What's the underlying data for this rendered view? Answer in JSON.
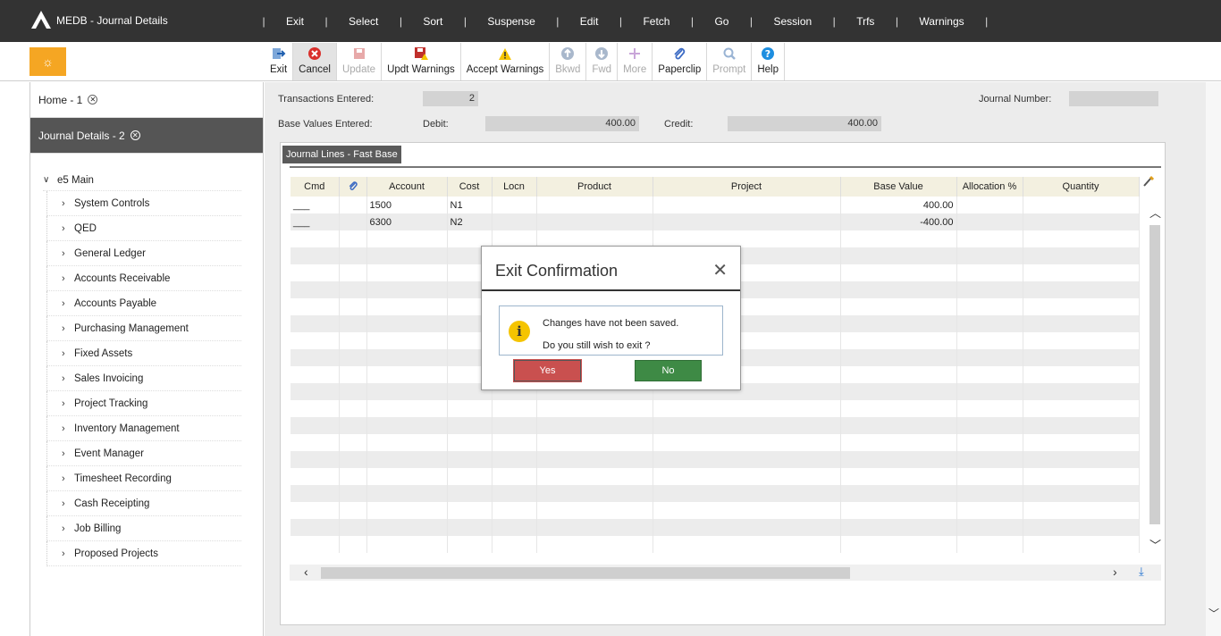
{
  "app": {
    "title": "MEDB - Journal Details"
  },
  "menu": [
    "Exit",
    "Select",
    "Sort",
    "Suspense",
    "Edit",
    "Fetch",
    "Go",
    "Session",
    "Trfs",
    "Warnings"
  ],
  "toolbar": {
    "exit": "Exit",
    "cancel": "Cancel",
    "update": "Update",
    "updt_warnings": "Updt Warnings",
    "accept_warnings": "Accept Warnings",
    "bkwd": "Bkwd",
    "fwd": "Fwd",
    "more": "More",
    "paperclip": "Paperclip",
    "prompt": "Prompt",
    "help": "Help"
  },
  "sidebar": {
    "tabs": [
      "Home - 1",
      "Journal Details - 2"
    ],
    "root": "e5 Main",
    "items": [
      "System Controls",
      "QED",
      "General Ledger",
      "Accounts Receivable",
      "Accounts Payable",
      "Purchasing Management",
      "Fixed Assets",
      "Sales Invoicing",
      "Project Tracking",
      "Inventory Management",
      "Event Manager",
      "Timesheet Recording",
      "Cash Receipting",
      "Job Billing",
      "Proposed Projects"
    ]
  },
  "header": {
    "transactions_label": "Transactions Entered:",
    "transactions_value": "2",
    "journal_number_label": "Journal Number:",
    "journal_number_value": "",
    "base_values_label": "Base Values Entered:",
    "debit_label": "Debit:",
    "debit_value": "400.00",
    "credit_label": "Credit:",
    "credit_value": "400.00"
  },
  "grid": {
    "tab_label": "Journal Lines - Fast Base",
    "columns": [
      "Cmd",
      "",
      "Account",
      "Cost",
      "Locn",
      "Product",
      "Project",
      "Base Value",
      "Allocation %",
      "Quantity"
    ],
    "rows": [
      [
        "___",
        "",
        "1500",
        "N1",
        "",
        "",
        "",
        "400.00",
        "",
        ""
      ],
      [
        "___",
        "",
        "6300",
        "N2",
        "",
        "",
        "",
        "-400.00",
        "",
        ""
      ]
    ]
  },
  "dialog": {
    "title": "Exit Confirmation",
    "message1": "Changes have not been saved.",
    "message2": "Do you still wish to exit ?",
    "yes": "Yes",
    "no": "No"
  },
  "colors": {
    "topbar": "#333333",
    "accent": "#f5a623",
    "yes": "#c9504f",
    "no": "#3e8a45"
  },
  "icons": [
    "logo-icon",
    "gear-icon",
    "exit-arrow-icon",
    "cancel-icon",
    "update-icon",
    "updt-warnings-icon",
    "warning-icon",
    "up-arrow-icon",
    "down-arrow-icon",
    "plus-icon",
    "paperclip-icon",
    "search-icon",
    "help-icon",
    "info-icon",
    "close-icon"
  ]
}
